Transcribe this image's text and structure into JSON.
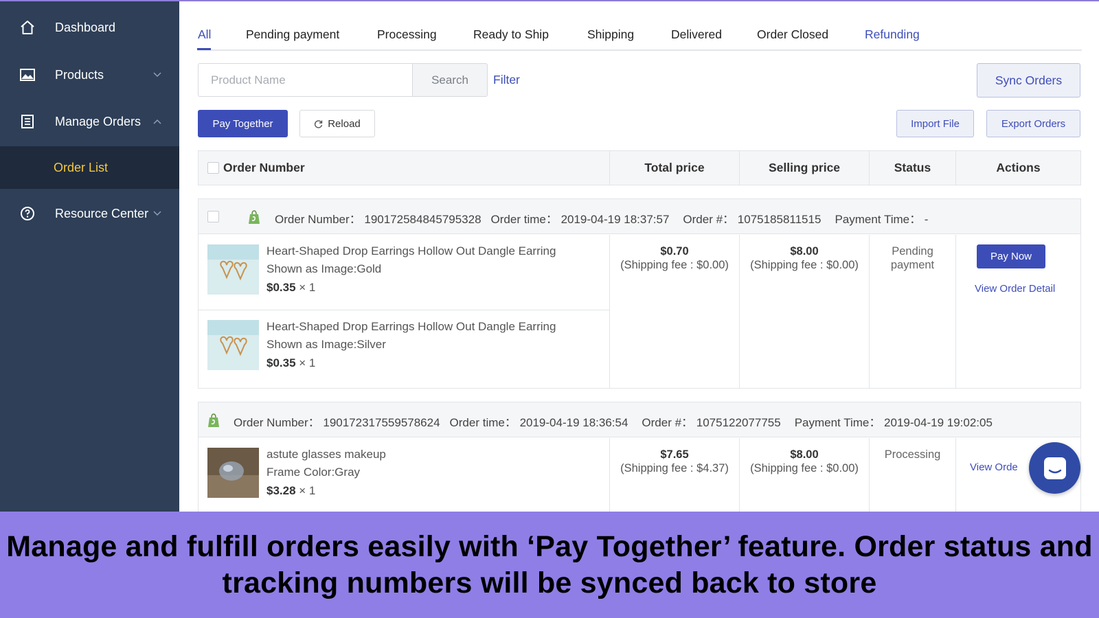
{
  "sidebar": {
    "items": [
      {
        "label": "Dashboard",
        "icon": "home-icon"
      },
      {
        "label": "Products",
        "icon": "image-icon"
      },
      {
        "label": "Manage Orders",
        "icon": "list-icon"
      },
      {
        "label": "Resource Center",
        "icon": "help-circle-icon"
      }
    ],
    "sub_item": "Order List"
  },
  "tabs": [
    "All",
    "Pending payment",
    "Processing",
    "Ready to Ship",
    "Shipping",
    "Delivered",
    "Order Closed",
    "Refunding"
  ],
  "toolbar": {
    "search_placeholder": "Product Name",
    "search_label": "Search",
    "filter_label": "Filter",
    "sync_label": "Sync Orders",
    "pay_together_label": "Pay Together",
    "reload_label": "Reload",
    "import_label": "Import File",
    "export_label": "Export Orders"
  },
  "table": {
    "headers": [
      "Order Number",
      "Total price",
      "Selling price",
      "Status",
      "Actions"
    ]
  },
  "orders": [
    {
      "order_number": "Order Number： 190172584845795328",
      "order_time": "Order time： 2019-04-19 18:37:57",
      "order_hash": "Order #： 1075185811515",
      "payment_time": "Payment Time： -",
      "items": [
        {
          "title": "Heart-Shaped Drop Earrings Hollow Out Dangle Earring",
          "variant": "Shown as Image:Gold",
          "price": "$0.35",
          "qty": " × 1"
        },
        {
          "title": "Heart-Shaped Drop Earrings Hollow Out Dangle Earring",
          "variant": "Shown as Image:Silver",
          "price": "$0.35",
          "qty": " × 1"
        }
      ],
      "total": "$0.70",
      "total_ship": "(Shipping fee : $0.00)",
      "selling": "$8.00",
      "selling_ship": "(Shipping fee : $0.00)",
      "status": "Pending payment",
      "action_primary": "Pay Now",
      "action_link": "View Order Detail"
    },
    {
      "order_number": "Order Number： 190172317559578624",
      "order_time": "Order time： 2019-04-19 18:36:54",
      "order_hash": "Order #： 1075122077755",
      "payment_time": "Payment Time： 2019-04-19 19:02:05",
      "items": [
        {
          "title": "astute glasses makeup",
          "variant": "Frame Color:Gray",
          "price": "$3.28",
          "qty": " × 1"
        }
      ],
      "total": "$7.65",
      "total_ship": "(Shipping fee : $4.37)",
      "selling": "$8.00",
      "selling_ship": "(Shipping fee : $0.00)",
      "status": "Processing",
      "action_link": "View Orde"
    }
  ],
  "caption": "Manage and fulfill orders easily with ‘Pay Together’ feature. Order status and tracking numbers will be synced back to store",
  "colors": {
    "sidebar_bg": "#2e3f57",
    "sidebar_active_bg": "#1f2b3c",
    "active_sub_text": "#f5c842",
    "accent": "#3d4db8",
    "caption_bg": "#8f7ee6"
  }
}
